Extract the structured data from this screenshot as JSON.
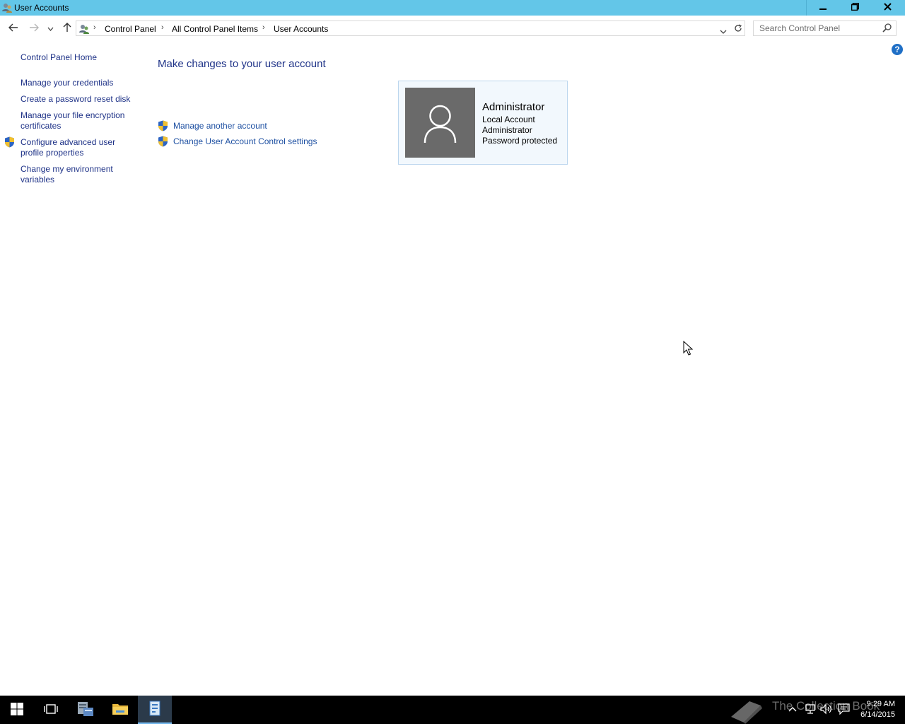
{
  "window": {
    "title": "User Accounts",
    "minimize_icon": "minimize-icon",
    "restore_icon": "restore-icon",
    "close_icon": "close-icon"
  },
  "address": {
    "crumbs": [
      "Control Panel",
      "All Control Panel Items",
      "User Accounts"
    ],
    "search_placeholder": "Search Control Panel"
  },
  "sidebar": {
    "home": "Control Panel Home",
    "links": [
      {
        "line1": "Manage your credentials",
        "line2": ""
      },
      {
        "line1": "Create a password reset disk",
        "line2": ""
      },
      {
        "line1": "Manage your file encryption",
        "line2": "certificates"
      },
      {
        "line1": "Configure advanced user",
        "line2": "profile properties"
      },
      {
        "line1": "Change my environment",
        "line2": "variables"
      }
    ]
  },
  "main": {
    "title": "Make changes to your user account",
    "tasks": [
      "Manage another account",
      "Change User Account Control settings"
    ]
  },
  "account": {
    "name": "Administrator",
    "type": "Local Account",
    "group": "Administrator",
    "status": "Password protected"
  },
  "taskbar": {
    "time": "9:29 AM",
    "date": "6/14/2015",
    "watermark": "The Collection Book"
  },
  "colors": {
    "titlebar": "#63c6e8",
    "link": "#1e3287",
    "card_bg": "#f2f8fd",
    "card_border": "#bcd6ee"
  }
}
